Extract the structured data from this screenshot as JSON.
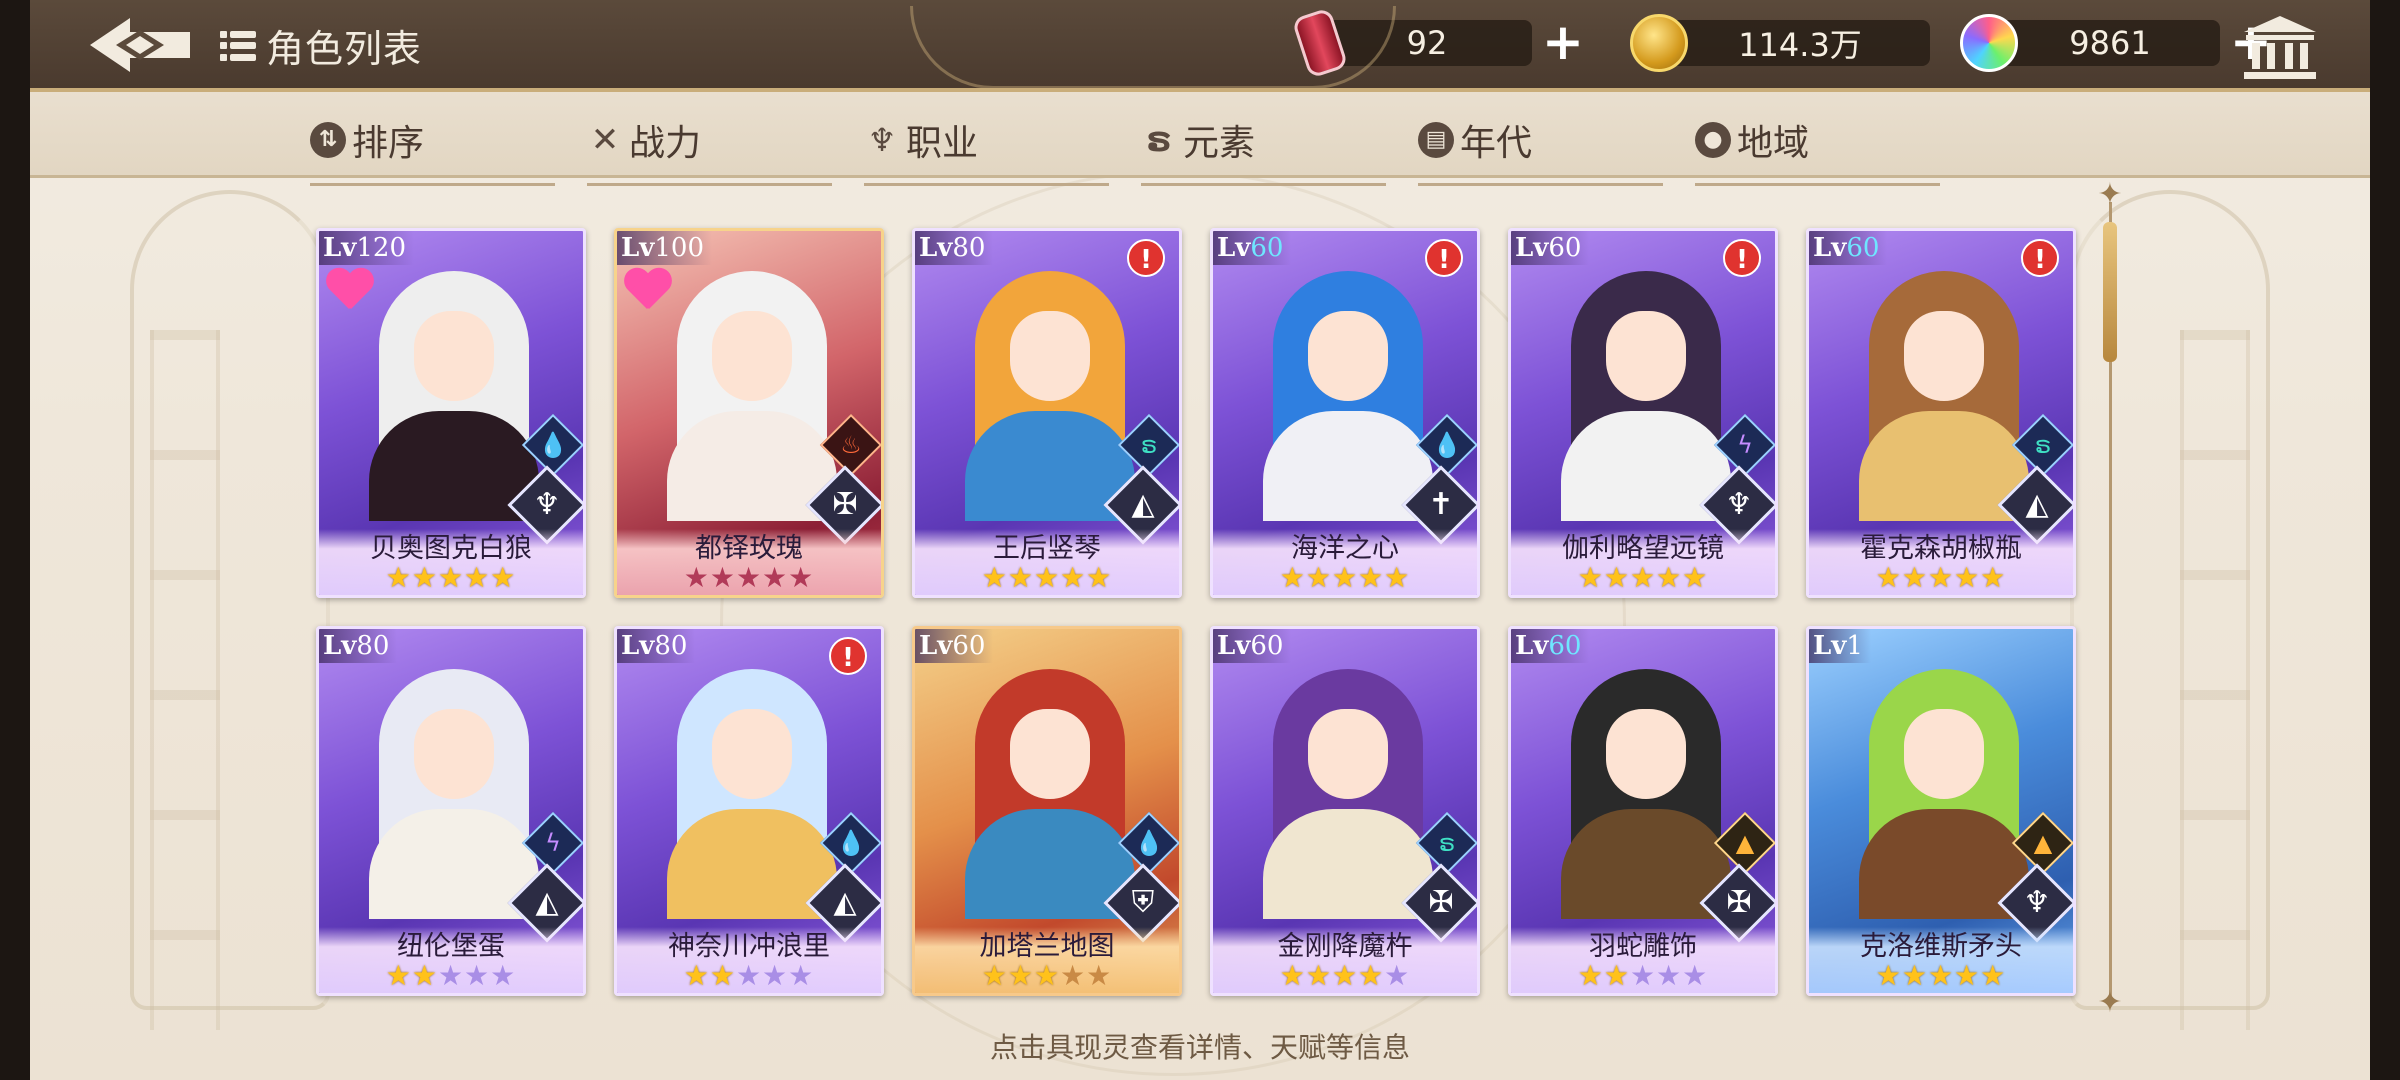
{
  "header": {
    "title": "角色列表",
    "resources": [
      {
        "icon": "soda-can-icon",
        "value": "92"
      },
      {
        "icon": "gold-coin-icon",
        "value": "114.3万"
      },
      {
        "icon": "rainbow-gem-icon",
        "value": "9861"
      }
    ]
  },
  "filters": [
    {
      "label": "排序",
      "icon": "sort-icon"
    },
    {
      "label": "战力",
      "icon": "crossed-swords-icon"
    },
    {
      "label": "职业",
      "icon": "class-emblem-icon"
    },
    {
      "label": "元素",
      "icon": "element-swirl-icon"
    },
    {
      "label": "年代",
      "icon": "calendar-icon"
    },
    {
      "label": "地域",
      "icon": "map-pin-icon"
    }
  ],
  "characters": [
    {
      "name": "贝奥图克白狼",
      "lv_label": "Lv",
      "level": "120",
      "stars": 5,
      "max_stars": 5,
      "rarity": "purple",
      "element": "water-drop-icon",
      "class": "trident-icon",
      "favorite": true,
      "alert": false
    },
    {
      "name": "都铎玫瑰",
      "lv_label": "Lv",
      "level": "100",
      "stars": 0,
      "max_stars": 5,
      "rarity": "red",
      "element": "fire-icon",
      "class": "winged-sword-icon",
      "favorite": true,
      "alert": false
    },
    {
      "name": "王后竖琴",
      "lv_label": "Lv",
      "level": "80",
      "stars": 5,
      "max_stars": 5,
      "rarity": "purple",
      "element": "wind-icon",
      "class": "book-icon",
      "favorite": false,
      "alert": true
    },
    {
      "name": "海洋之心",
      "lv_label": "Lv",
      "level": "60",
      "stars": 5,
      "max_stars": 5,
      "rarity": "purple",
      "element": "water-drop-icon",
      "class": "cross-icon",
      "favorite": false,
      "alert": true,
      "level_color": "#6fe6ff"
    },
    {
      "name": "伽利略望远镜",
      "lv_label": "Lv",
      "level": "60",
      "stars": 5,
      "max_stars": 5,
      "rarity": "purple",
      "element": "thunder-icon",
      "class": "trident-icon",
      "favorite": false,
      "alert": true
    },
    {
      "name": "霍克森胡椒瓶",
      "lv_label": "Lv",
      "level": "60",
      "stars": 5,
      "max_stars": 5,
      "rarity": "purple",
      "element": "wind-icon",
      "class": "book-icon",
      "favorite": false,
      "alert": true,
      "level_color": "#6fe6ff"
    },
    {
      "name": "纽伦堡蛋",
      "lv_label": "Lv",
      "level": "80",
      "stars": 2,
      "max_stars": 5,
      "rarity": "purple",
      "element": "thunder-icon",
      "class": "book-icon",
      "favorite": false,
      "alert": false
    },
    {
      "name": "神奈川冲浪里",
      "lv_label": "Lv",
      "level": "80",
      "stars": 2,
      "max_stars": 5,
      "rarity": "purple",
      "element": "water-drop-icon",
      "class": "book-icon",
      "favorite": false,
      "alert": true
    },
    {
      "name": "加塔兰地图",
      "lv_label": "Lv",
      "level": "60",
      "stars": 3,
      "max_stars": 5,
      "rarity": "gold",
      "element": "water-drop-icon",
      "class": "shield-icon",
      "favorite": false,
      "alert": false
    },
    {
      "name": "金刚降魔杵",
      "lv_label": "Lv",
      "level": "60",
      "stars": 4,
      "max_stars": 5,
      "rarity": "purple",
      "element": "wind-icon",
      "class": "winged-sword-icon",
      "favorite": false,
      "alert": false
    },
    {
      "name": "羽蛇雕饰",
      "lv_label": "Lv",
      "level": "60",
      "stars": 2,
      "max_stars": 5,
      "rarity": "purple",
      "element": "earth-icon",
      "class": "winged-sword-icon",
      "favorite": false,
      "alert": false,
      "level_color": "#6fe6ff"
    },
    {
      "name": "克洛维斯矛头",
      "lv_label": "Lv",
      "level": "1",
      "stars": 5,
      "max_stars": 5,
      "rarity": "blue",
      "element": "earth-icon",
      "class": "trident-icon",
      "favorite": false,
      "alert": false
    }
  ],
  "hint": "点击具现灵查看详情、天赋等信息",
  "colors": {
    "accent_gold": "#c9ad7a",
    "alert_red": "#e0332f",
    "star_gold": "#ffc21a"
  }
}
